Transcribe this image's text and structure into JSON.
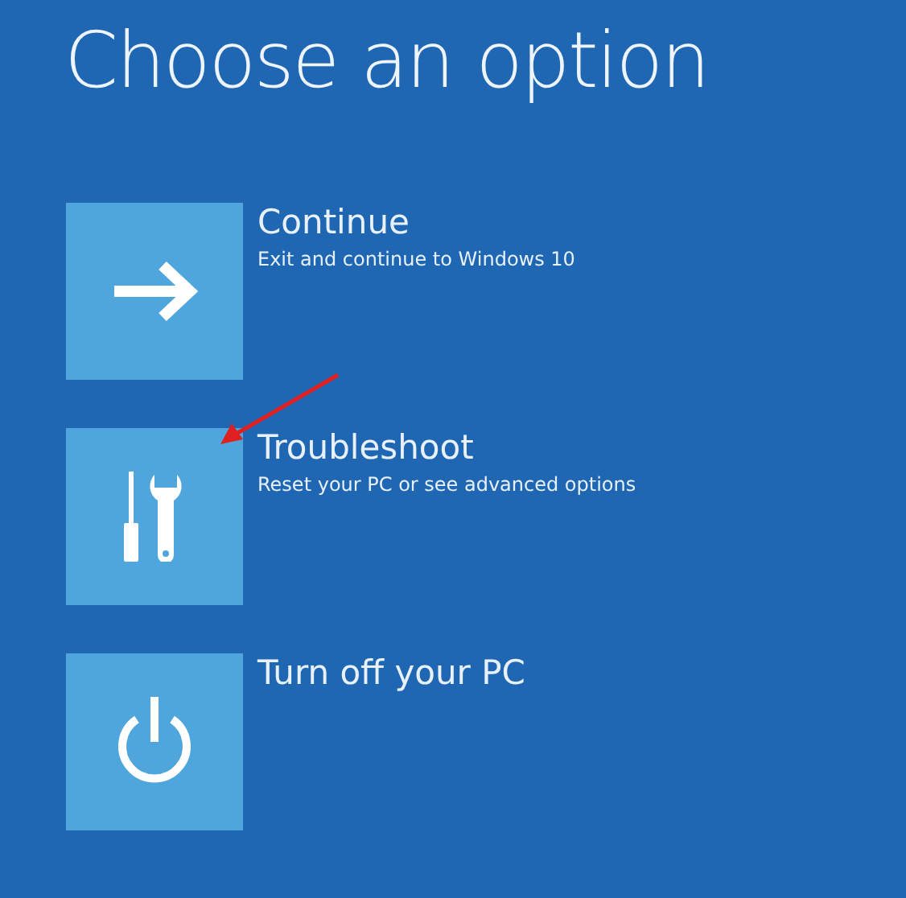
{
  "title": "Choose an option",
  "options": [
    {
      "kind": "arrow",
      "label": "Continue",
      "description": "Exit and continue to Windows 10"
    },
    {
      "kind": "tools",
      "label": "Troubleshoot",
      "description": "Reset your PC or see advanced options"
    },
    {
      "kind": "power",
      "label": "Turn off your PC"
    }
  ]
}
